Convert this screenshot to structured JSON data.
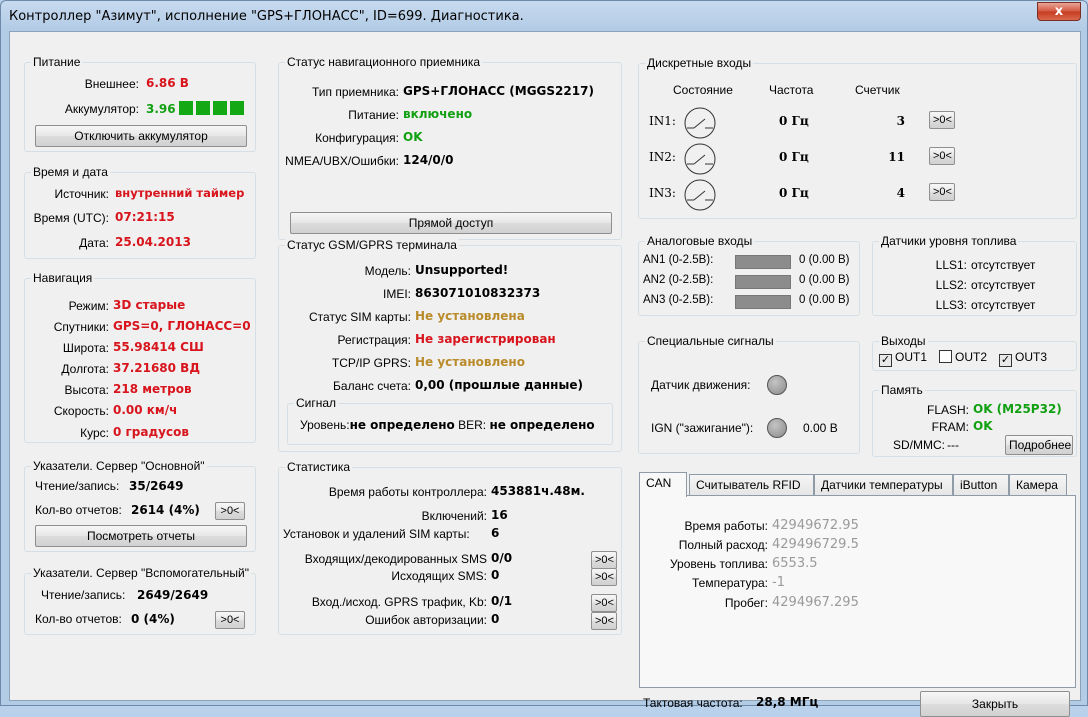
{
  "window": {
    "title": "Контроллер \"Азимут\", исполнение \"GPS+ГЛОНАСС\", ID=699. Диагностика.",
    "close_glyph": "x"
  },
  "power": {
    "title": "Питание",
    "external_label": "Внешнее:",
    "external_value": "6.86 В",
    "battery_label": "Аккумулятор:",
    "battery_value": "3.96",
    "disconnect_button": "Отключить аккумулятор"
  },
  "datetime": {
    "title": "Время и дата",
    "source_label": "Источник:",
    "source_value": "внутренний таймер",
    "time_label": "Время (UTC):",
    "time_value": "07:21:15",
    "date_label": "Дата:",
    "date_value": "25.04.2013"
  },
  "navigation": {
    "title": "Навигация",
    "mode_label": "Режим:",
    "mode_value": "3D старые",
    "sats_label": "Спутники:",
    "sats_value": "GPS=0, ГЛОНАСС=0",
    "lat_label": "Широта:",
    "lat_value": "55.98414 СШ",
    "lon_label": "Долгота:",
    "lon_value": "37.21680 ВД",
    "alt_label": "Высота:",
    "alt_value": "218 метров",
    "speed_label": "Скорость:",
    "speed_value": "0.00 км/ч",
    "course_label": "Курс:",
    "course_value": "0 градусов"
  },
  "server_main": {
    "title": "Указатели. Сервер \"Основной\"",
    "rw_label": "Чтение/запись:",
    "rw_value": "35/2649",
    "count_label": "Кол-во отчетов:",
    "count_value": "2614 (4%)",
    "reset_button": ">0<",
    "view_button": "Посмотреть отчеты"
  },
  "server_aux": {
    "title": "Указатели. Сервер \"Вспомогательный\"",
    "rw_label": "Чтение/запись:",
    "rw_value": "2649/2649",
    "count_label": "Кол-во отчетов:",
    "count_value": "0 (4%)",
    "reset_button": ">0<"
  },
  "nav_receiver": {
    "title": "Статус навигационного приемника",
    "type_label": "Тип приемника:",
    "type_value": "GPS+ГЛОНАСС (MGGS2217)",
    "power_label": "Питание:",
    "power_value": "включено",
    "config_label": "Конфигурация:",
    "config_value": "OK",
    "nmea_label": "NMEA/UBX/Ошибки:",
    "nmea_value": "124/0/0",
    "direct_button": "Прямой доступ"
  },
  "gsm": {
    "title": "Статус GSM/GPRS терминала",
    "model_label": "Модель:",
    "model_value": "Unsupported!",
    "imei_label": "IMEI:",
    "imei_value": "863071010832373",
    "sim_label": "Статус SIM карты:",
    "sim_value": "Не установлена",
    "reg_label": "Регистрация:",
    "reg_value": "Не зарегистрирован",
    "tcp_label": "TCP/IP GPRS:",
    "tcp_value": "Не установлено",
    "balance_label": "Баланс счета:",
    "balance_value": "0,00 (прошлые данные)",
    "signal": {
      "title": "Сигнал",
      "level_label": "Уровень:",
      "level_value": "не определено",
      "ber_label": "BER:",
      "ber_value": "не определено"
    }
  },
  "stats": {
    "title": "Статистика",
    "uptime_label": "Время работы контроллера:",
    "uptime_value": "453881ч.48м.",
    "on_label": "Включений:",
    "on_value": "16",
    "sim_label": "Установок и удалений SIM карты:",
    "sim_value": "6",
    "sms_in_label": "Входящих/декодированных SMS",
    "sms_in_value": "0/0",
    "sms_out_label": "Исходящих SMS:",
    "sms_out_value": "0",
    "gprs_label": "Вход./исход. GPRS трафик, Kb:",
    "gprs_value": "0/1",
    "auth_label": "Ошибок авторизации:",
    "auth_value": "0",
    "reset_button": ">0<"
  },
  "discrete": {
    "title": "Дискретные входы",
    "col_state": "Состояние",
    "col_freq": "Частота",
    "col_counter": "Счетчик",
    "reset_button": ">0<",
    "rows": [
      {
        "name": "IN1:",
        "freq": "0 Гц",
        "count": "3"
      },
      {
        "name": "IN2:",
        "freq": "0 Гц",
        "count": "11"
      },
      {
        "name": "IN3:",
        "freq": "0 Гц",
        "count": "4"
      }
    ]
  },
  "analog": {
    "title": "Аналоговые входы",
    "rows": [
      {
        "name": "AN1 (0-2.5В):",
        "value": "0 (0.00 В)",
        "level": 0
      },
      {
        "name": "AN2 (0-2.5В):",
        "value": "0 (0.00 В)",
        "level": 0
      },
      {
        "name": "AN3 (0-2.5В):",
        "value": "0 (0.00 В)",
        "level": 0
      }
    ]
  },
  "fuel": {
    "title": "Датчики уровня топлива",
    "rows": [
      {
        "name": "LLS1:",
        "value": "отсутствует"
      },
      {
        "name": "LLS2:",
        "value": "отсутствует"
      },
      {
        "name": "LLS3:",
        "value": "отсутствует"
      }
    ]
  },
  "special": {
    "title": "Специальные сигналы",
    "motion_label": "Датчик движения:",
    "ign_label": "IGN (\"зажигание\"):",
    "ign_value": "0.00 В"
  },
  "outputs": {
    "title": "Выходы",
    "items": [
      {
        "label": "OUT1",
        "checked": true,
        "mark": "✓"
      },
      {
        "label": "OUT2",
        "checked": false,
        "mark": ""
      },
      {
        "label": "OUT3",
        "checked": true,
        "mark": "✓"
      }
    ]
  },
  "memory": {
    "title": "Память",
    "flash_label": "FLASH:",
    "flash_value": "OK (M25P32)",
    "fram_label": "FRAM:",
    "fram_value": "OK",
    "sd_label": "SD/MMC:",
    "sd_value": "---",
    "details_button": "Подробнее"
  },
  "tabs": {
    "items": [
      "CAN",
      "Считыватель RFID",
      "Датчики температуры",
      "iButton",
      "Камера"
    ],
    "can": {
      "uptime_label": "Время работы:",
      "uptime_value": "42949672.95",
      "consumption_label": "Полный расход:",
      "consumption_value": "429496729.5",
      "fuel_label": "Уровень топлива:",
      "fuel_value": "6553.5",
      "temp_label": "Температура:",
      "temp_value": "-1",
      "mileage_label": "Пробег:",
      "mileage_value": "4294967.295"
    }
  },
  "footer": {
    "clock_label": "Тактовая частота:",
    "clock_value": "28,8 МГц",
    "close_button": "Закрыть"
  }
}
